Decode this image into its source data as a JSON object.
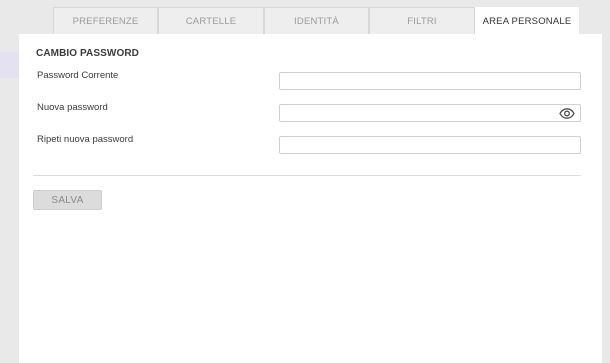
{
  "tabs": [
    {
      "label": "PREFERENZE",
      "active": false
    },
    {
      "label": "CARTELLE",
      "active": false
    },
    {
      "label": "IDENTITÀ",
      "active": false
    },
    {
      "label": "FILTRI",
      "active": false
    },
    {
      "label": "AREA PERSONALE",
      "active": true
    }
  ],
  "section": {
    "title": "CAMBIO PASSWORD"
  },
  "fields": {
    "current_password": {
      "label": "Password Corrente",
      "value": "",
      "placeholder": ""
    },
    "new_password": {
      "label": "Nuova password",
      "value": "",
      "placeholder": ""
    },
    "repeat_password": {
      "label": "Ripeti nuova password",
      "value": "",
      "placeholder": ""
    }
  },
  "actions": {
    "save_label": "SALVA"
  },
  "icons": {
    "show_password": "eye-icon"
  },
  "colors": {
    "background": "#e9e9e9",
    "panel": "#ffffff",
    "tab_inactive": "#eeeeee",
    "tab_active": "#ffffff",
    "button_disabled": "#dcdcdc"
  }
}
